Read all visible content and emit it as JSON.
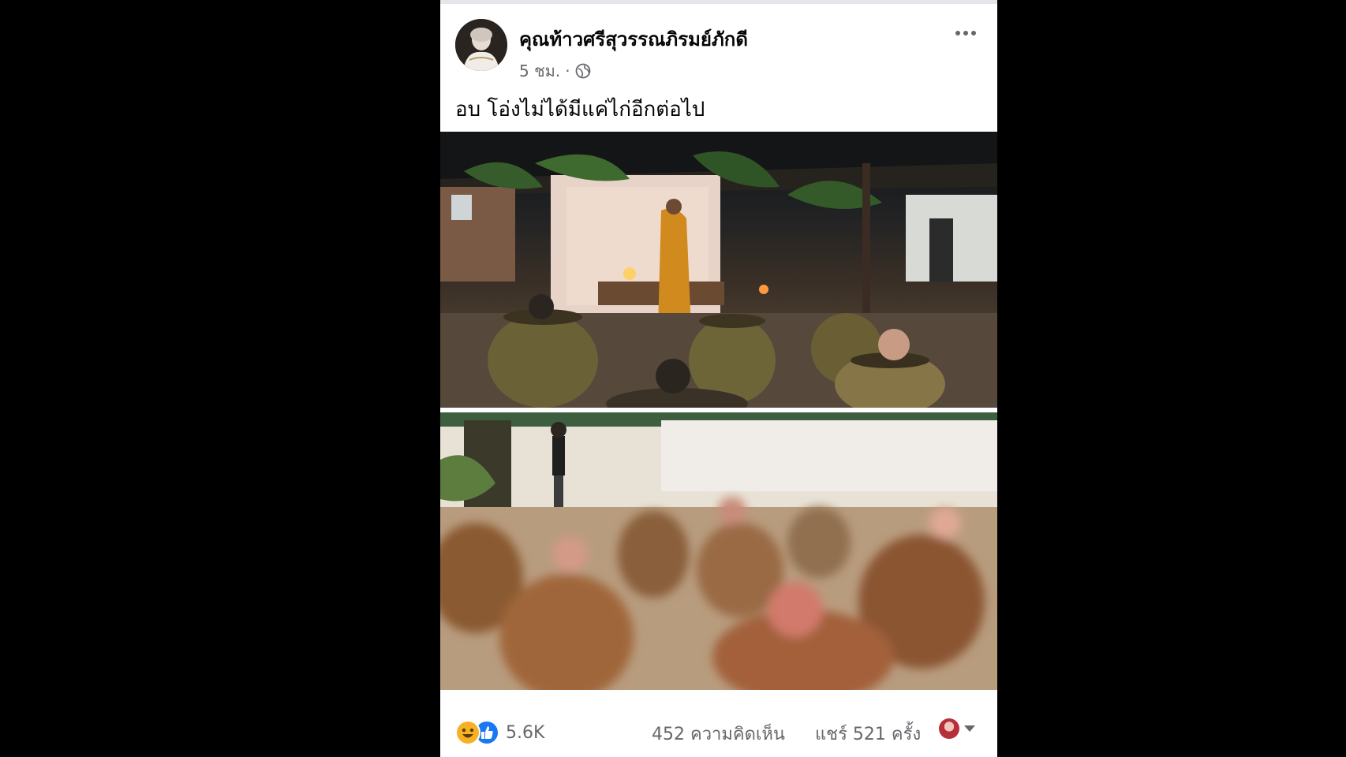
{
  "post": {
    "author": "คุณท้าวศรีสุวรรณภิรมย์ภักดี",
    "time": "5 ชม.",
    "separator": "·",
    "privacy_icon": "globe-icon",
    "more_icon": "more-horizontal-icon",
    "text": "อบ โอ่งไม่ได้มีแค่ไก่อีกต่อไป"
  },
  "photos": [
    {
      "icon": "photo-ritual-night"
    },
    {
      "icon": "photo-jars-outdoor-blurred"
    }
  ],
  "stats": {
    "reaction_icons": [
      "haha-icon",
      "like-icon"
    ],
    "reactions": "5.6K",
    "comments": "452 ความคิดเห็น",
    "shares": "แชร์ 521 ครั้ง"
  },
  "colors": {
    "background": "#000000",
    "card": "#ffffff",
    "secondary_text": "#65676b",
    "like_blue": "#1877f2",
    "haha_yellow": "#f7b125"
  }
}
